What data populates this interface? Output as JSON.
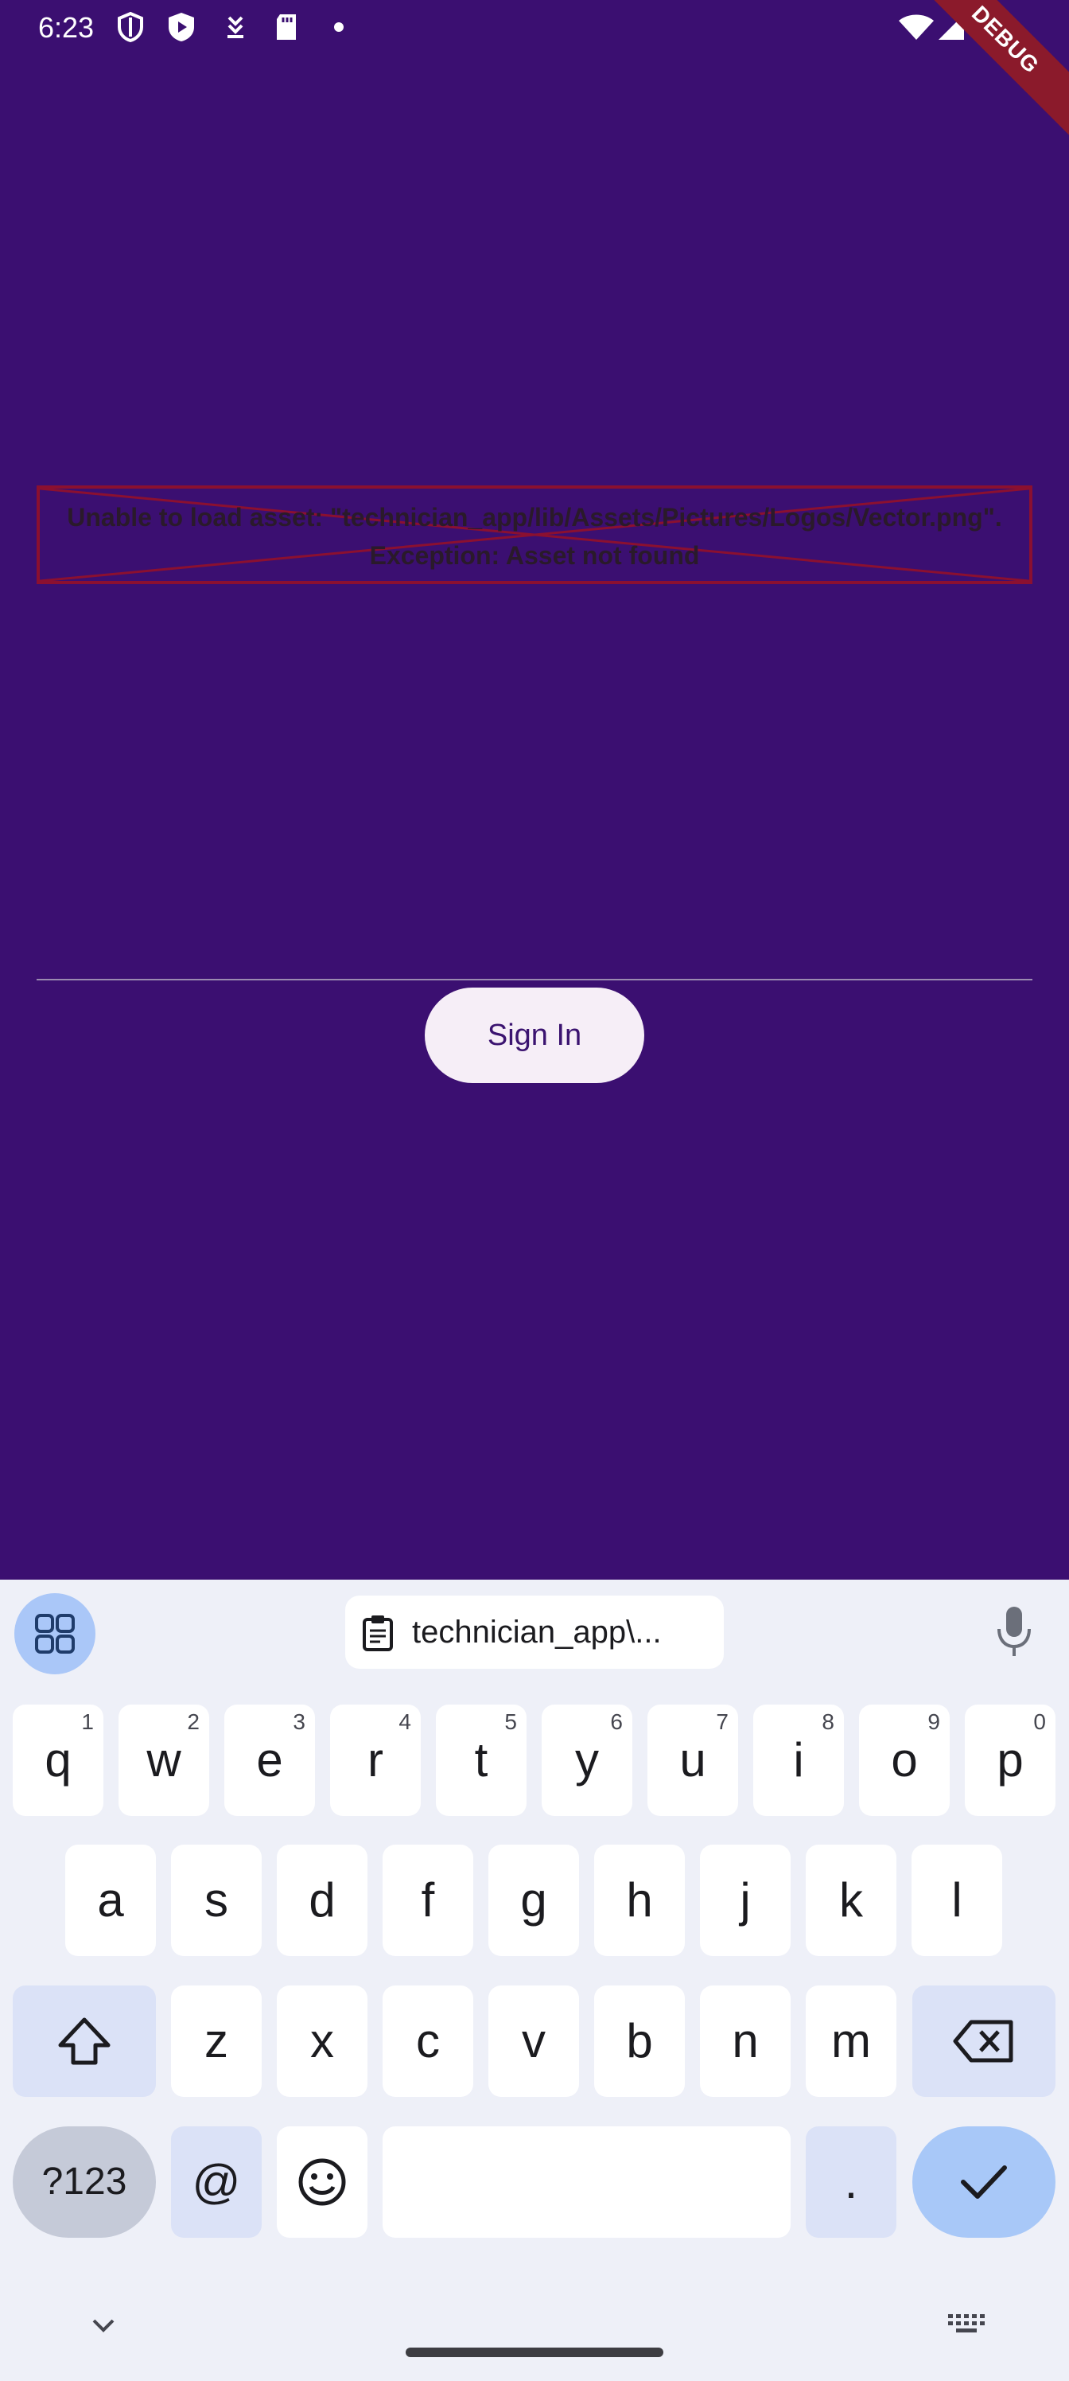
{
  "status_bar": {
    "time": "6:23",
    "debug_label": "DEBUG",
    "icons": [
      "shield-icon",
      "play-protect-icon",
      "download-icon",
      "sd-card-icon",
      "dot-icon",
      "wifi-icon",
      "signal-icon",
      "battery-icon"
    ]
  },
  "app": {
    "error_message": "Unable to load asset: \"technician_app/lib/Assets/Pictures/Logos/Vector.png\".",
    "error_exception": "Exception: Asset not found",
    "input_value": "",
    "signin_label": "Sign In",
    "colors": {
      "background": "#3b0f71",
      "error": "#8b1030",
      "button": "#f6eef7",
      "button_text": "#3b1370"
    }
  },
  "keyboard": {
    "clipboard_text": "technician_app\\...",
    "row1": [
      {
        "label": "q",
        "hint": "1"
      },
      {
        "label": "w",
        "hint": "2"
      },
      {
        "label": "e",
        "hint": "3"
      },
      {
        "label": "r",
        "hint": "4"
      },
      {
        "label": "t",
        "hint": "5"
      },
      {
        "label": "y",
        "hint": "6"
      },
      {
        "label": "u",
        "hint": "7"
      },
      {
        "label": "i",
        "hint": "8"
      },
      {
        "label": "o",
        "hint": "9"
      },
      {
        "label": "p",
        "hint": "0"
      }
    ],
    "row2": [
      "a",
      "s",
      "d",
      "f",
      "g",
      "h",
      "j",
      "k",
      "l"
    ],
    "row3": [
      "z",
      "x",
      "c",
      "v",
      "b",
      "n",
      "m"
    ],
    "symbols_label": "?123",
    "at_label": "@",
    "period_label": "."
  }
}
